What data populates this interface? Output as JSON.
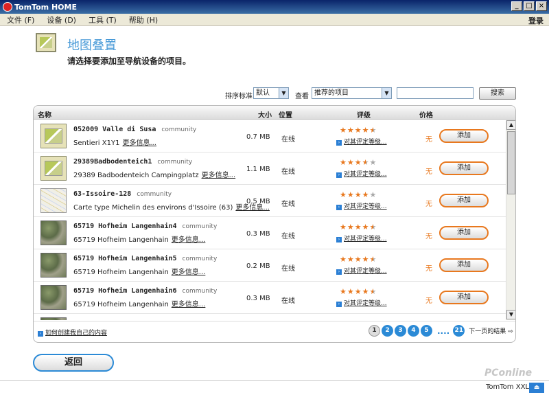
{
  "window": {
    "title": "TomTom HOME",
    "min": "_",
    "max": "□",
    "close": "×"
  },
  "menu": [
    {
      "label": "文件 (F)"
    },
    {
      "label": "设备 (D)"
    },
    {
      "label": "工具 (T)"
    },
    {
      "label": "帮助 (H)"
    }
  ],
  "login": "登录",
  "header": {
    "title": "地图叠置",
    "subtitle": "请选择要添加至导航设备的项目。"
  },
  "filters": {
    "sort_label": "排序标准",
    "sort_value": "默认",
    "view_label": "查看",
    "view_value": "推荐的项目",
    "search_placeholder": "",
    "search_button": "搜索"
  },
  "columns": {
    "name": "名称",
    "size": "大小",
    "location": "位置",
    "rating": "评级",
    "price": "价格"
  },
  "items": [
    {
      "name": "052009 Valle di Susa",
      "source": "community",
      "desc": "Sentieri X1Y1",
      "more": "更多信息...",
      "size": "0.7 MB",
      "location": "在线",
      "rating": 4.5,
      "rate_link": "对其评定等级...",
      "price": "无",
      "add": "添加",
      "thumb": "icon"
    },
    {
      "name": "29389Badbodenteich1",
      "source": "community",
      "desc": "29389 Badbodenteich Campingplatz",
      "more": "更多信息...",
      "size": "1.1 MB",
      "location": "在线",
      "rating": 3.5,
      "rate_link": "对其评定等级...",
      "price": "无",
      "add": "添加",
      "thumb": "icon"
    },
    {
      "name": "63-Issoire-128",
      "source": "community",
      "desc": "Carte type Michelin des environs d'Issoire (63)",
      "more": "更多信息...",
      "size": "0.5 MB",
      "location": "在线",
      "rating": 4,
      "rate_link": "对其评定等级...",
      "price": "无",
      "add": "添加",
      "thumb": "map"
    },
    {
      "name": "65719 Hofheim Langenhain4",
      "source": "community",
      "desc": "65719 Hofheim Langenhain",
      "more": "更多信息...",
      "size": "0.3 MB",
      "location": "在线",
      "rating": 4.5,
      "rate_link": "对其评定等级...",
      "price": "无",
      "add": "添加",
      "thumb": "aerial"
    },
    {
      "name": "65719 Hofheim Langenhain5",
      "source": "community",
      "desc": "65719 Hofheim Langenhain",
      "more": "更多信息...",
      "size": "0.2 MB",
      "location": "在线",
      "rating": 4.5,
      "rate_link": "对其评定等级...",
      "price": "无",
      "add": "添加",
      "thumb": "aerial"
    },
    {
      "name": "65719 Hofheim Langenhain6",
      "source": "community",
      "desc": "65719 Hofheim Langenhain",
      "more": "更多信息...",
      "size": "0.3 MB",
      "location": "在线",
      "rating": 4.5,
      "rate_link": "对其评定等级...",
      "price": "无",
      "add": "添加",
      "thumb": "aerial"
    }
  ],
  "footer": {
    "howto": "如何创建我自己的内容",
    "pages": [
      "1",
      "2",
      "3",
      "4",
      "5"
    ],
    "dots": "....",
    "last_page": "21",
    "next": "下一页的结果 ⇨"
  },
  "back_button": "返回",
  "status": {
    "device": "TomTom XXL",
    "eject": "⏏"
  },
  "watermark": "PConline"
}
